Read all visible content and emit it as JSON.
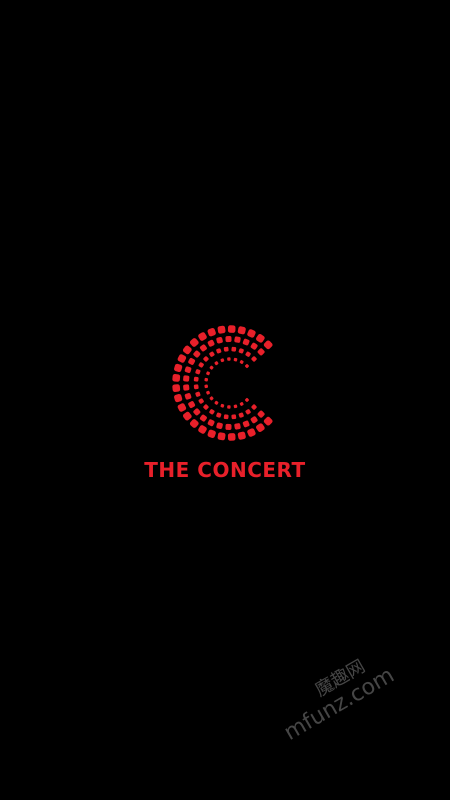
{
  "splash": {
    "brand_name": "THE CONCERT",
    "logo_icon": "dotted-c-logo-icon",
    "brand_color": "#e8202a",
    "background_color": "#000000"
  },
  "watermark": {
    "line1": "魔趣网",
    "line2": "mfunz.com"
  }
}
